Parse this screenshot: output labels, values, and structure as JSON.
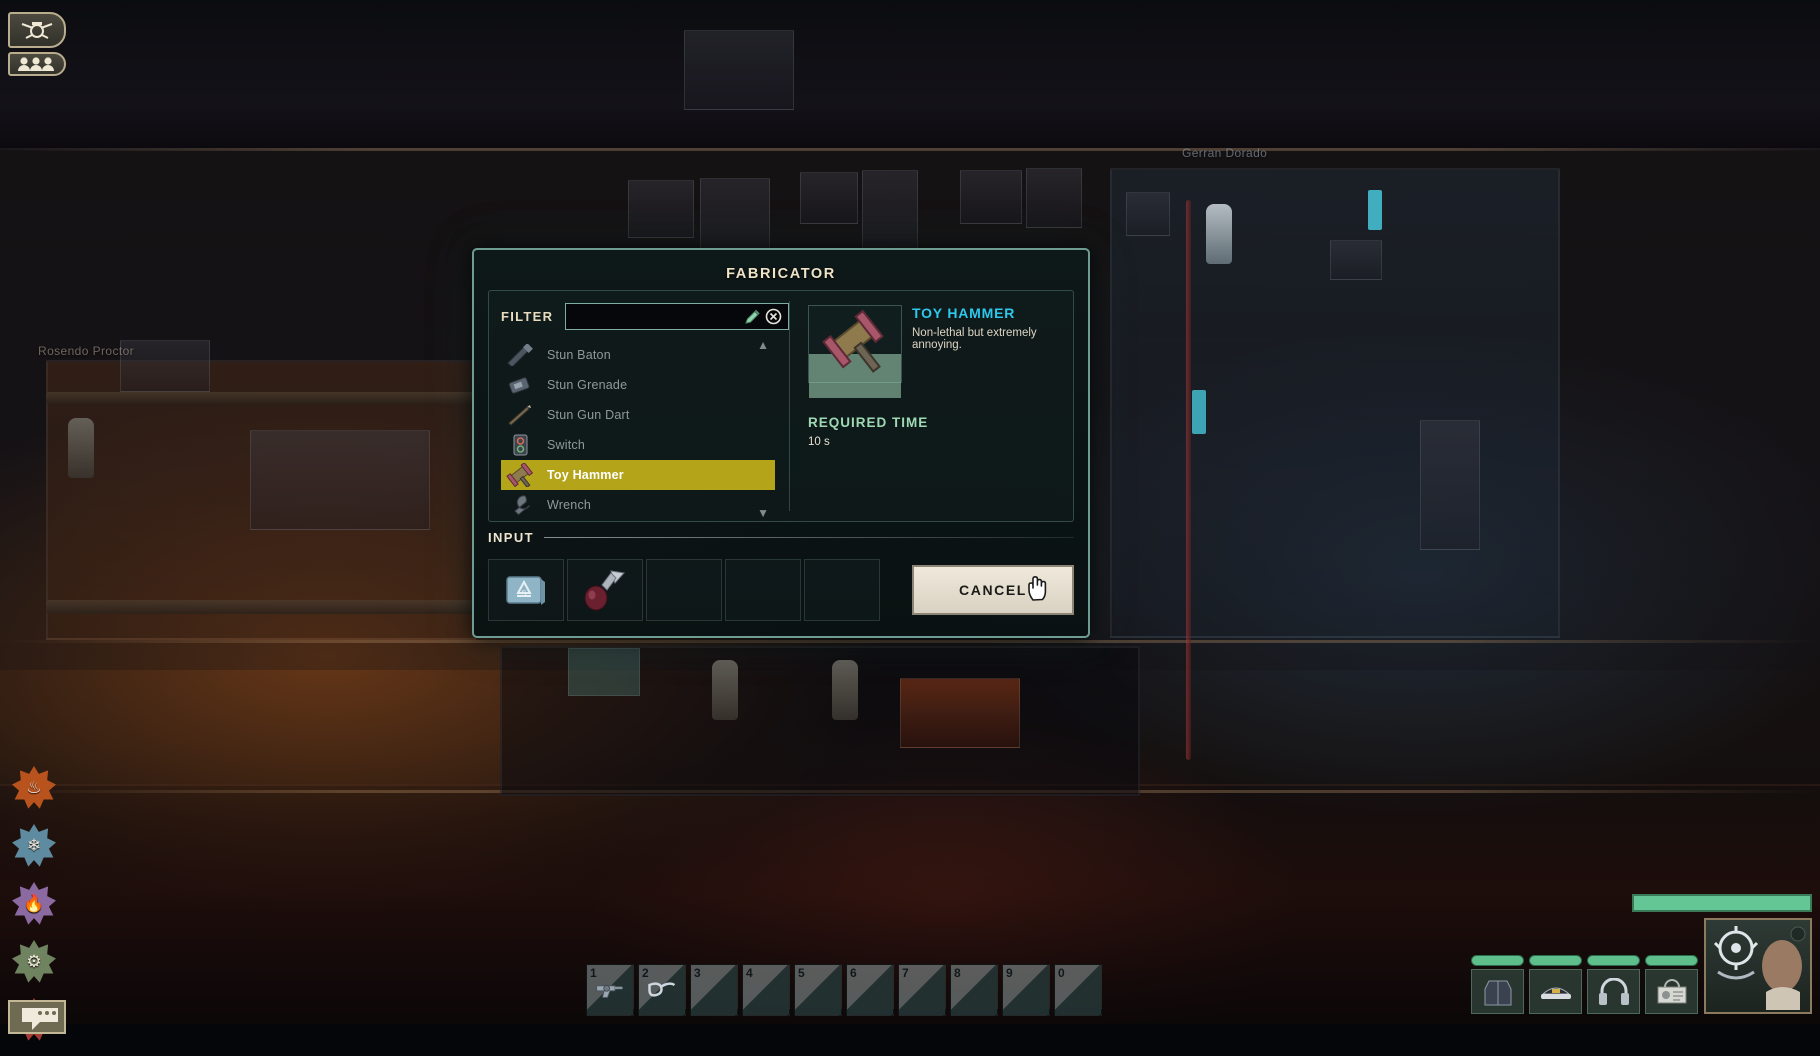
{
  "hud": {
    "top_buttons": [
      {
        "name": "submarine-view-button",
        "icon": "submarine-icon"
      },
      {
        "name": "crew-list-button",
        "icon": "crew-icon"
      }
    ],
    "skills": [
      {
        "name": "weapons-skill",
        "icon": "flame-icon",
        "color": "#b8531e",
        "glyph": "♣"
      },
      {
        "name": "electrical-skill",
        "icon": "snowflake-icon",
        "color": "#5f8ba0",
        "glyph": "❄"
      },
      {
        "name": "helm-skill",
        "icon": "flame-purple-icon",
        "color": "#8a6aa0",
        "glyph": "⚘"
      },
      {
        "name": "mechanical-skill",
        "icon": "gears-icon",
        "color": "#6f8360",
        "glyph": "⚙"
      },
      {
        "name": "medical-skill",
        "icon": "medical-cross-icon",
        "color": "#a53a34",
        "glyph": "✚"
      }
    ],
    "chat_button": {
      "name": "chat-button",
      "icon": "speech-bubble-icon"
    },
    "hotbar": {
      "slots": [
        {
          "key": "1",
          "item": "revolver"
        },
        {
          "key": "2",
          "item": "pipe"
        },
        {
          "key": "3",
          "item": ""
        },
        {
          "key": "4",
          "item": ""
        },
        {
          "key": "5",
          "item": ""
        },
        {
          "key": "6",
          "item": ""
        },
        {
          "key": "7",
          "item": ""
        },
        {
          "key": "8",
          "item": ""
        },
        {
          "key": "9",
          "item": ""
        },
        {
          "key": "0",
          "item": ""
        }
      ]
    },
    "equipment": [
      {
        "name": "equip-slot-jacket",
        "item": "jacket"
      },
      {
        "name": "equip-slot-headset-cap",
        "item": "captain-cap"
      },
      {
        "name": "equip-slot-headphones",
        "item": "headset"
      },
      {
        "name": "equip-slot-id-card",
        "item": "id-card"
      }
    ],
    "character_name": "Gerran Dorado",
    "other_character_name": "Rosendo Proctor"
  },
  "fabricator": {
    "title": "FABRICATOR",
    "filter": {
      "label": "FILTER",
      "value": "",
      "placeholder": "",
      "edit_icon": "pencil-icon",
      "clear_icon": "clear-circle-x-icon"
    },
    "items": [
      {
        "name": "Stun Baton",
        "icon": "stun-baton-icon",
        "selected": false
      },
      {
        "name": "Stun Grenade",
        "icon": "stun-grenade-icon",
        "selected": false
      },
      {
        "name": "Stun Gun Dart",
        "icon": "stun-gun-dart-icon",
        "selected": false
      },
      {
        "name": "Switch",
        "icon": "switch-icon",
        "selected": false
      },
      {
        "name": "Toy Hammer",
        "icon": "toy-hammer-icon",
        "selected": true
      },
      {
        "name": "Wrench",
        "icon": "wrench-icon",
        "selected": false
      }
    ],
    "detail": {
      "title": "TOY HAMMER",
      "description": "Non-lethal but extremely annoying.",
      "required_time_label": "REQUIRED TIME",
      "required_time_value": "10 s",
      "preview_icon": "toy-hammer-icon"
    },
    "input": {
      "label": "INPUT",
      "slots": [
        {
          "name": "input-slot-1",
          "item": "plastic-material",
          "icon": "recycle-5-icon"
        },
        {
          "name": "input-slot-2",
          "item": "horn",
          "icon": "horn-icon"
        },
        {
          "name": "input-slot-3",
          "item": "",
          "icon": ""
        },
        {
          "name": "input-slot-4",
          "item": "",
          "icon": ""
        },
        {
          "name": "input-slot-5",
          "item": "",
          "icon": ""
        }
      ]
    },
    "cancel_label": "CANCEL",
    "cursor_icon": "hand-cursor-icon"
  },
  "colors": {
    "accent_cyan": "#2ec8ec",
    "accent_green": "#9fd9b4",
    "selection_yellow": "#b3a419",
    "window_border": "#6e9c93",
    "title_cream": "#efe3c8"
  }
}
